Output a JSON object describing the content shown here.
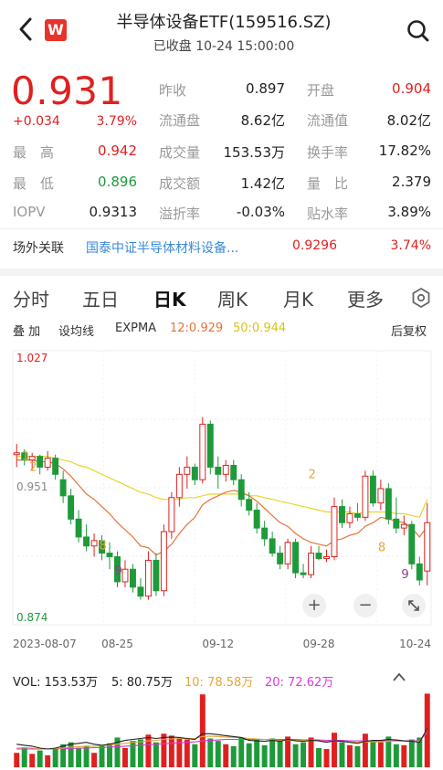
{
  "header": {
    "title": "半导体设备ETF(159516.SZ)",
    "subtitle": "已收盘 10-24 15:00:00",
    "logo_text": "W"
  },
  "quote": {
    "price": "0.931",
    "change": "+0.034",
    "change_pct": "3.79%",
    "stats": [
      {
        "label": "昨收",
        "value": "0.897",
        "color": "dark"
      },
      {
        "label": "开盘",
        "value": "0.904",
        "color": "red"
      },
      {
        "label": "流通盘",
        "value": "8.62亿",
        "color": "dark"
      },
      {
        "label": "流通值",
        "value": "8.02亿",
        "color": "dark"
      },
      {
        "label": "最　高",
        "value": "0.942",
        "color": "red"
      },
      {
        "label": "成交量",
        "value": "153.53万",
        "color": "dark"
      },
      {
        "label": "换手率",
        "value": "17.82%",
        "color": "dark"
      },
      {
        "label": "最　低",
        "value": "0.896",
        "color": "green"
      },
      {
        "label": "成交额",
        "value": "1.42亿",
        "color": "dark"
      },
      {
        "label": "量　比",
        "value": "2.379",
        "color": "dark"
      },
      {
        "label": "IOPV",
        "value": "0.9313",
        "color": "dark"
      },
      {
        "label": "溢折率",
        "value": "-0.03%",
        "color": "dark"
      },
      {
        "label": "贴水率",
        "value": "3.89%",
        "color": "dark"
      }
    ]
  },
  "related": {
    "label": "场外关联",
    "fund_name": "国泰中证半导体材料设备...",
    "fund_value": "0.9296",
    "fund_pct": "3.74%"
  },
  "tabs": [
    "分时",
    "五日",
    "日K",
    "周K",
    "月K",
    "更多"
  ],
  "active_tab": "日K",
  "indicators": {
    "overlay": "叠 加",
    "ma_setting": "设均线",
    "expma": "EXPMA",
    "ema12": "12:0.929",
    "ema50": "50:0.944",
    "adjust": "后复权"
  },
  "colors": {
    "up": "#e02020",
    "down": "#1f9a3a",
    "ema12": "#e8733a",
    "ema50": "#e6d629",
    "vol5": "#222222",
    "vol10": "#e8a33a",
    "vol20": "#d63ad6"
  },
  "volume": {
    "vol": "VOL: 153.53万",
    "ma5": "5: 80.75万",
    "ma10": "10: 78.58万",
    "ma20": "20: 72.62万"
  },
  "chart_data": {
    "type": "candlestick",
    "y_max_label": "1.027",
    "y_mid_label": "0.951",
    "y_min_label": "0.874",
    "ylim": [
      0.874,
      1.027
    ],
    "x_tick_labels": [
      "2023-08-07",
      "08-25",
      "09-12",
      "09-28",
      "10-24"
    ],
    "markers": [
      "1",
      "2",
      "8",
      "9",
      "2",
      "8",
      "9"
    ],
    "candles": [
      {
        "o": 0.969,
        "h": 0.975,
        "l": 0.962,
        "c": 0.97
      },
      {
        "o": 0.97,
        "h": 0.972,
        "l": 0.963,
        "c": 0.966
      },
      {
        "o": 0.966,
        "h": 0.97,
        "l": 0.96,
        "c": 0.968
      },
      {
        "o": 0.968,
        "h": 0.969,
        "l": 0.958,
        "c": 0.962
      },
      {
        "o": 0.962,
        "h": 0.971,
        "l": 0.96,
        "c": 0.967
      },
      {
        "o": 0.967,
        "h": 0.969,
        "l": 0.955,
        "c": 0.958
      },
      {
        "o": 0.955,
        "h": 0.96,
        "l": 0.942,
        "c": 0.946
      },
      {
        "o": 0.946,
        "h": 0.95,
        "l": 0.93,
        "c": 0.933
      },
      {
        "o": 0.933,
        "h": 0.938,
        "l": 0.92,
        "c": 0.923
      },
      {
        "o": 0.923,
        "h": 0.93,
        "l": 0.915,
        "c": 0.918
      },
      {
        "o": 0.918,
        "h": 0.925,
        "l": 0.912,
        "c": 0.921
      },
      {
        "o": 0.921,
        "h": 0.924,
        "l": 0.91,
        "c": 0.914
      },
      {
        "o": 0.914,
        "h": 0.92,
        "l": 0.905,
        "c": 0.912
      },
      {
        "o": 0.912,
        "h": 0.915,
        "l": 0.895,
        "c": 0.898
      },
      {
        "o": 0.898,
        "h": 0.91,
        "l": 0.895,
        "c": 0.905
      },
      {
        "o": 0.905,
        "h": 0.908,
        "l": 0.892,
        "c": 0.895
      },
      {
        "o": 0.895,
        "h": 0.9,
        "l": 0.888,
        "c": 0.89
      },
      {
        "o": 0.89,
        "h": 0.915,
        "l": 0.888,
        "c": 0.91
      },
      {
        "o": 0.91,
        "h": 0.914,
        "l": 0.89,
        "c": 0.893
      },
      {
        "o": 0.893,
        "h": 0.93,
        "l": 0.89,
        "c": 0.926
      },
      {
        "o": 0.926,
        "h": 0.948,
        "l": 0.922,
        "c": 0.945
      },
      {
        "o": 0.945,
        "h": 0.962,
        "l": 0.94,
        "c": 0.958
      },
      {
        "o": 0.958,
        "h": 0.968,
        "l": 0.95,
        "c": 0.962
      },
      {
        "o": 0.962,
        "h": 0.964,
        "l": 0.952,
        "c": 0.955
      },
      {
        "o": 0.955,
        "h": 0.99,
        "l": 0.953,
        "c": 0.986
      },
      {
        "o": 0.986,
        "h": 0.988,
        "l": 0.958,
        "c": 0.962
      },
      {
        "o": 0.962,
        "h": 0.968,
        "l": 0.95,
        "c": 0.958
      },
      {
        "o": 0.958,
        "h": 0.966,
        "l": 0.954,
        "c": 0.963
      },
      {
        "o": 0.963,
        "h": 0.966,
        "l": 0.952,
        "c": 0.955
      },
      {
        "o": 0.955,
        "h": 0.958,
        "l": 0.94,
        "c": 0.944
      },
      {
        "o": 0.944,
        "h": 0.948,
        "l": 0.935,
        "c": 0.938
      },
      {
        "o": 0.938,
        "h": 0.942,
        "l": 0.925,
        "c": 0.928
      },
      {
        "o": 0.928,
        "h": 0.932,
        "l": 0.918,
        "c": 0.922
      },
      {
        "o": 0.922,
        "h": 0.926,
        "l": 0.912,
        "c": 0.914
      },
      {
        "o": 0.914,
        "h": 0.918,
        "l": 0.905,
        "c": 0.908
      },
      {
        "o": 0.908,
        "h": 0.922,
        "l": 0.905,
        "c": 0.92
      },
      {
        "o": 0.92,
        "h": 0.922,
        "l": 0.9,
        "c": 0.903
      },
      {
        "o": 0.903,
        "h": 0.908,
        "l": 0.9,
        "c": 0.902
      },
      {
        "o": 0.902,
        "h": 0.918,
        "l": 0.9,
        "c": 0.914
      },
      {
        "o": 0.914,
        "h": 0.918,
        "l": 0.91,
        "c": 0.911
      },
      {
        "o": 0.911,
        "h": 0.916,
        "l": 0.909,
        "c": 0.912
      },
      {
        "o": 0.912,
        "h": 0.945,
        "l": 0.91,
        "c": 0.94
      },
      {
        "o": 0.94,
        "h": 0.944,
        "l": 0.928,
        "c": 0.931
      },
      {
        "o": 0.931,
        "h": 0.94,
        "l": 0.928,
        "c": 0.936
      },
      {
        "o": 0.936,
        "h": 0.942,
        "l": 0.932,
        "c": 0.934
      },
      {
        "o": 0.934,
        "h": 0.96,
        "l": 0.932,
        "c": 0.957
      },
      {
        "o": 0.957,
        "h": 0.96,
        "l": 0.94,
        "c": 0.942
      },
      {
        "o": 0.942,
        "h": 0.955,
        "l": 0.938,
        "c": 0.95
      },
      {
        "o": 0.95,
        "h": 0.953,
        "l": 0.93,
        "c": 0.933
      },
      {
        "o": 0.933,
        "h": 0.945,
        "l": 0.925,
        "c": 0.928
      },
      {
        "o": 0.928,
        "h": 0.935,
        "l": 0.924,
        "c": 0.93
      },
      {
        "o": 0.93,
        "h": 0.932,
        "l": 0.905,
        "c": 0.908
      },
      {
        "o": 0.908,
        "h": 0.912,
        "l": 0.896,
        "c": 0.899
      },
      {
        "o": 0.904,
        "h": 0.942,
        "l": 0.896,
        "c": 0.931
      }
    ],
    "ema12": [
      0.966,
      0.966,
      0.966,
      0.965,
      0.965,
      0.964,
      0.961,
      0.957,
      0.952,
      0.947,
      0.944,
      0.94,
      0.936,
      0.931,
      0.927,
      0.923,
      0.918,
      0.917,
      0.913,
      0.915,
      0.919,
      0.925,
      0.93,
      0.934,
      0.941,
      0.944,
      0.946,
      0.948,
      0.949,
      0.948,
      0.946,
      0.943,
      0.939,
      0.935,
      0.931,
      0.929,
      0.925,
      0.922,
      0.92,
      0.919,
      0.918,
      0.921,
      0.922,
      0.924,
      0.925,
      0.929,
      0.931,
      0.934,
      0.933,
      0.932,
      0.931,
      0.928,
      0.923,
      0.929
    ],
    "ema50": [
      0.968,
      0.968,
      0.968,
      0.968,
      0.968,
      0.967,
      0.966,
      0.965,
      0.963,
      0.962,
      0.96,
      0.958,
      0.956,
      0.954,
      0.952,
      0.95,
      0.948,
      0.947,
      0.945,
      0.944,
      0.944,
      0.944,
      0.945,
      0.945,
      0.946,
      0.947,
      0.947,
      0.947,
      0.947,
      0.947,
      0.946,
      0.946,
      0.945,
      0.944,
      0.943,
      0.942,
      0.941,
      0.94,
      0.939,
      0.938,
      0.937,
      0.937,
      0.937,
      0.937,
      0.936,
      0.937,
      0.937,
      0.937,
      0.937,
      0.936,
      0.936,
      0.935,
      0.934,
      0.944
    ],
    "volumes": [
      30,
      42,
      28,
      35,
      25,
      38,
      48,
      52,
      40,
      45,
      30,
      46,
      50,
      62,
      40,
      55,
      58,
      68,
      52,
      70,
      66,
      60,
      58,
      48,
      152,
      60,
      55,
      48,
      44,
      62,
      50,
      58,
      46,
      60,
      55,
      64,
      48,
      52,
      62,
      40,
      38,
      72,
      52,
      46,
      44,
      70,
      56,
      52,
      64,
      48,
      46,
      58,
      62,
      153.53
    ],
    "vol5": [
      48,
      46,
      44,
      40,
      38,
      40,
      44,
      48,
      50,
      52,
      48,
      46,
      48,
      52,
      56,
      58,
      60,
      62,
      60,
      62,
      63,
      62,
      60,
      58,
      70,
      70,
      68,
      66,
      64,
      62,
      56,
      55,
      54,
      56,
      54,
      58,
      55,
      54,
      56,
      55,
      52,
      55,
      54,
      52,
      50,
      54,
      56,
      56,
      58,
      57,
      55,
      54,
      52,
      80.75
    ],
    "vol10": [
      40,
      41,
      40,
      39,
      38,
      39,
      40,
      42,
      43,
      44,
      44,
      45,
      46,
      48,
      50,
      52,
      53,
      55,
      56,
      58,
      59,
      60,
      60,
      60,
      64,
      65,
      64,
      63,
      62,
      62,
      60,
      59,
      58,
      57,
      56,
      57,
      56,
      56,
      56,
      55,
      54,
      54,
      54,
      53,
      52,
      53,
      53,
      53,
      54,
      54,
      54,
      54,
      54,
      78.58
    ],
    "vol20": [
      38,
      38,
      38,
      38,
      38,
      38,
      39,
      39,
      40,
      40,
      41,
      41,
      42,
      43,
      44,
      45,
      46,
      47,
      48,
      49,
      50,
      51,
      52,
      53,
      55,
      56,
      57,
      58,
      58,
      58,
      58,
      58,
      58,
      58,
      58,
      58,
      58,
      57,
      57,
      57,
      56,
      56,
      56,
      55,
      55,
      55,
      55,
      55,
      55,
      55,
      55,
      55,
      55,
      72.62
    ]
  }
}
